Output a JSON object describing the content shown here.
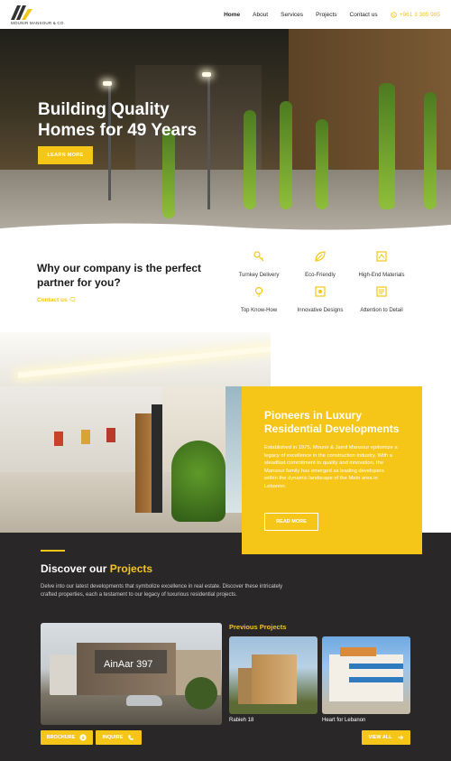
{
  "header": {
    "logo_text": "MOUNIR MANSOUR & CO.",
    "nav": [
      {
        "label": "Home",
        "active": true
      },
      {
        "label": "About",
        "active": false
      },
      {
        "label": "Services",
        "active": false
      },
      {
        "label": "Projects",
        "active": false
      },
      {
        "label": "Contact us",
        "active": false
      }
    ],
    "phone": "+961 3 385 985",
    "phone_icon": "whatsapp-icon"
  },
  "hero": {
    "title_line1": "Building Quality",
    "title_line2": "Homes for 49 Years",
    "button": "LEARN MORE"
  },
  "why": {
    "title": "Why our company is the perfect partner for you?",
    "link": "Contact us",
    "features": [
      {
        "label": "Turnkey Delivery",
        "icon": "key-icon"
      },
      {
        "label": "Eco-Friendly",
        "icon": "leaf-icon"
      },
      {
        "label": "High-End Materials",
        "icon": "materials-icon"
      },
      {
        "label": "Top Know-How",
        "icon": "lightbulb-icon"
      },
      {
        "label": "Innovative Designs",
        "icon": "design-icon"
      },
      {
        "label": "Attention to Detail",
        "icon": "detail-icon"
      }
    ]
  },
  "pioneers": {
    "title": "Pioneers in Luxury Residential Developments",
    "body": "Established in 1975, Mounir & Jamil Mansour epitomize a legacy of excellence in the construction industry. With a steadfast commitment to quality and innovation, the Mansour family has emerged as leading developers within the dynamic landscape of the Metn area in Lebanon.",
    "button": "READ MORE"
  },
  "projects": {
    "title_prefix": "Discover our ",
    "title_highlight": "Projects",
    "description": "Delve into our latest developments that symbolize excellence in real estate. Discover these intricately crafted properties, each a testament to our legacy of luxurious residential projects.",
    "main_project": "AinAar 397",
    "previous_title": "Previous Projects",
    "previous": [
      {
        "name": "Rabieh 18"
      },
      {
        "name": "Heart for Lebanon"
      }
    ],
    "brochure": "BROCHURE",
    "inquire": "INQUIRE",
    "view_all": "VIEW ALL"
  },
  "colors": {
    "accent": "#f5c518",
    "dark": "#2a2728"
  }
}
